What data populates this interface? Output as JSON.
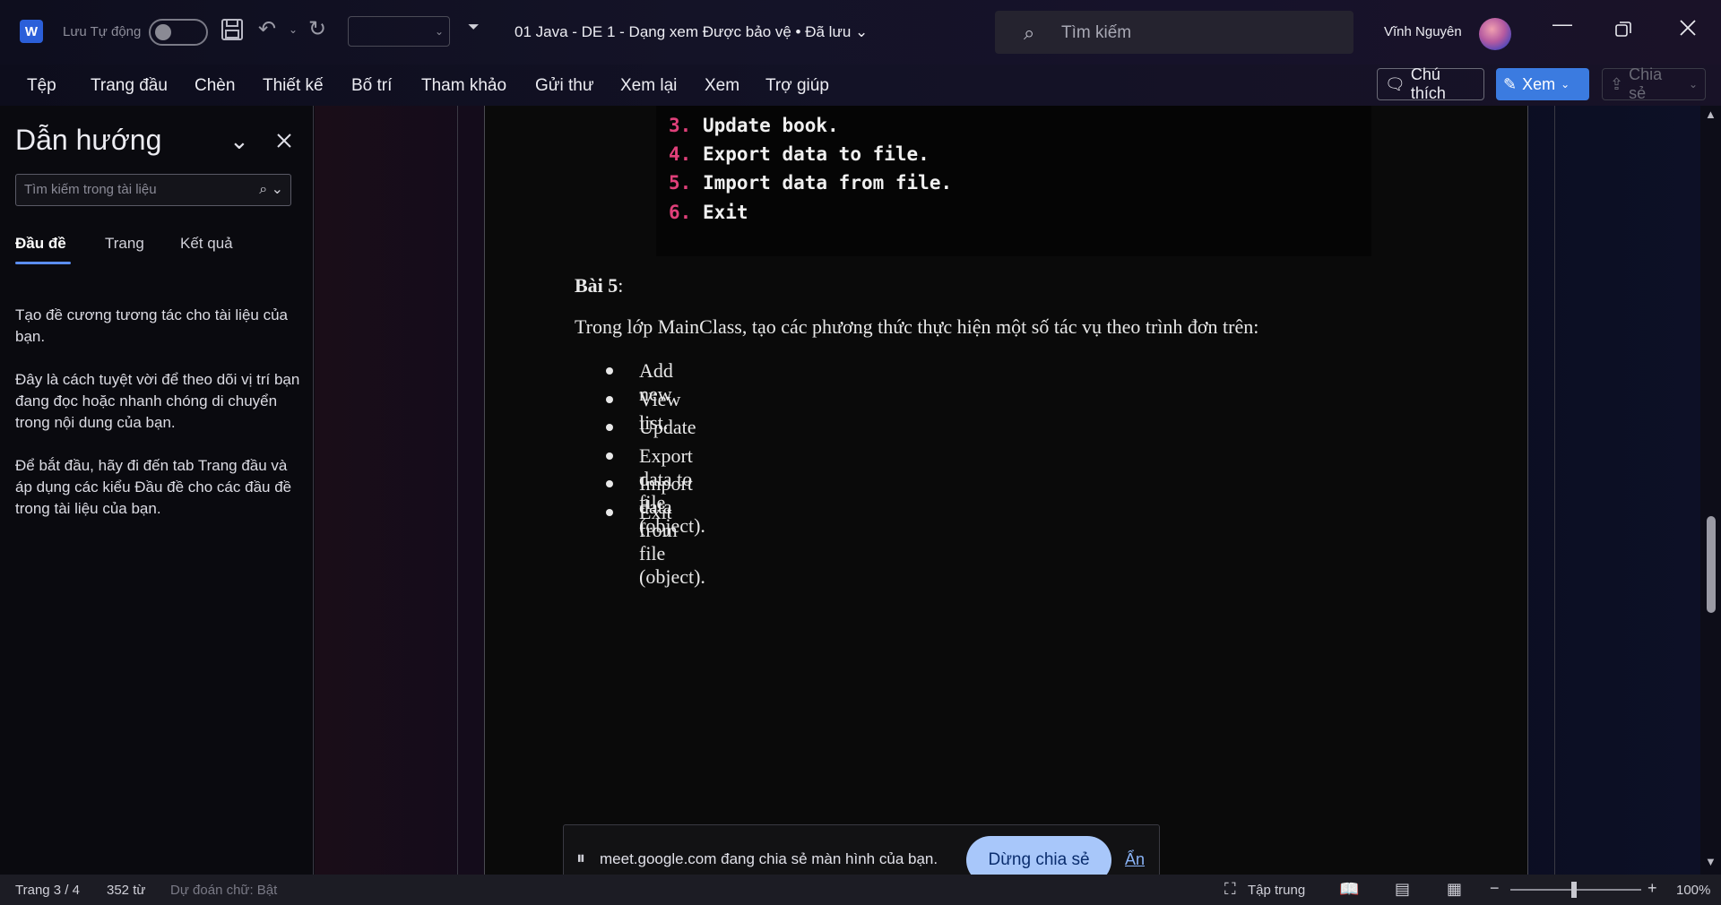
{
  "titlebar": {
    "autosave_label": "Lưu Tự động",
    "doc_title": "01 Java - DE 1  -  Dạng xem Được bảo vệ • Đã lưu ⌄",
    "search_placeholder": "Tìm kiếm",
    "user_name": "Vĩnh Nguyên",
    "app_icon_letter": "W"
  },
  "ribbon": {
    "tabs": [
      "Tệp",
      "Trang đầu",
      "Chèn",
      "Thiết kế",
      "Bố trí",
      "Tham khảo",
      "Gửi thư",
      "Xem lại",
      "Xem",
      "Trợ giúp"
    ],
    "comments_label": "Chú thích",
    "view_label": "Xem",
    "share_label": "Chia sẻ"
  },
  "navpane": {
    "title": "Dẫn hướng",
    "search_placeholder": "Tìm kiếm trong tài liệu",
    "tabs": [
      "Đầu đề",
      "Trang",
      "Kết quả"
    ],
    "paragraphs": [
      "Tạo đề cương tương tác cho tài liệu của bạn.",
      "Đây là cách tuyệt vời để theo dõi vị trí bạn đang đọc hoặc nhanh chóng di chuyển trong nội dung của bạn.",
      "Để bắt đầu, hãy đi đến tab Trang đầu và áp dụng các kiểu Đầu đề cho các đầu đề trong tài liệu của bạn."
    ]
  },
  "document": {
    "code_lines": [
      {
        "num": "3.",
        "text": "Update book."
      },
      {
        "num": "4.",
        "text": "Export data to file."
      },
      {
        "num": "5.",
        "text": "Import data from file."
      },
      {
        "num": "6.",
        "text": "Exit"
      }
    ],
    "heading_bold": "Bài 5",
    "heading_rest": ":",
    "paragraph": "Trong lớp MainClass, tạo các phương thức thực hiện một số tác vụ theo trình đơn trên:",
    "bullets": [
      "Add new",
      "View list.",
      "Update",
      "Export data to file (object).",
      "Import data from file (object).",
      "Exit"
    ]
  },
  "share_banner": {
    "message": "meet.google.com đang chia sẻ màn hình của bạn.",
    "stop_label": "Dừng chia sẻ",
    "hide_label": "Ẩn"
  },
  "statusbar": {
    "page": "Trang 3 / 4",
    "words": "352 từ",
    "prediction": "Dự đoán chữ: Bật",
    "focus_label": "Tập trung",
    "zoom": "100%"
  },
  "colors": {
    "accent": "#3b7be0",
    "code_number": "#e0407a",
    "stop_button": "#a8c7fa",
    "link": "#8ab4f8"
  }
}
